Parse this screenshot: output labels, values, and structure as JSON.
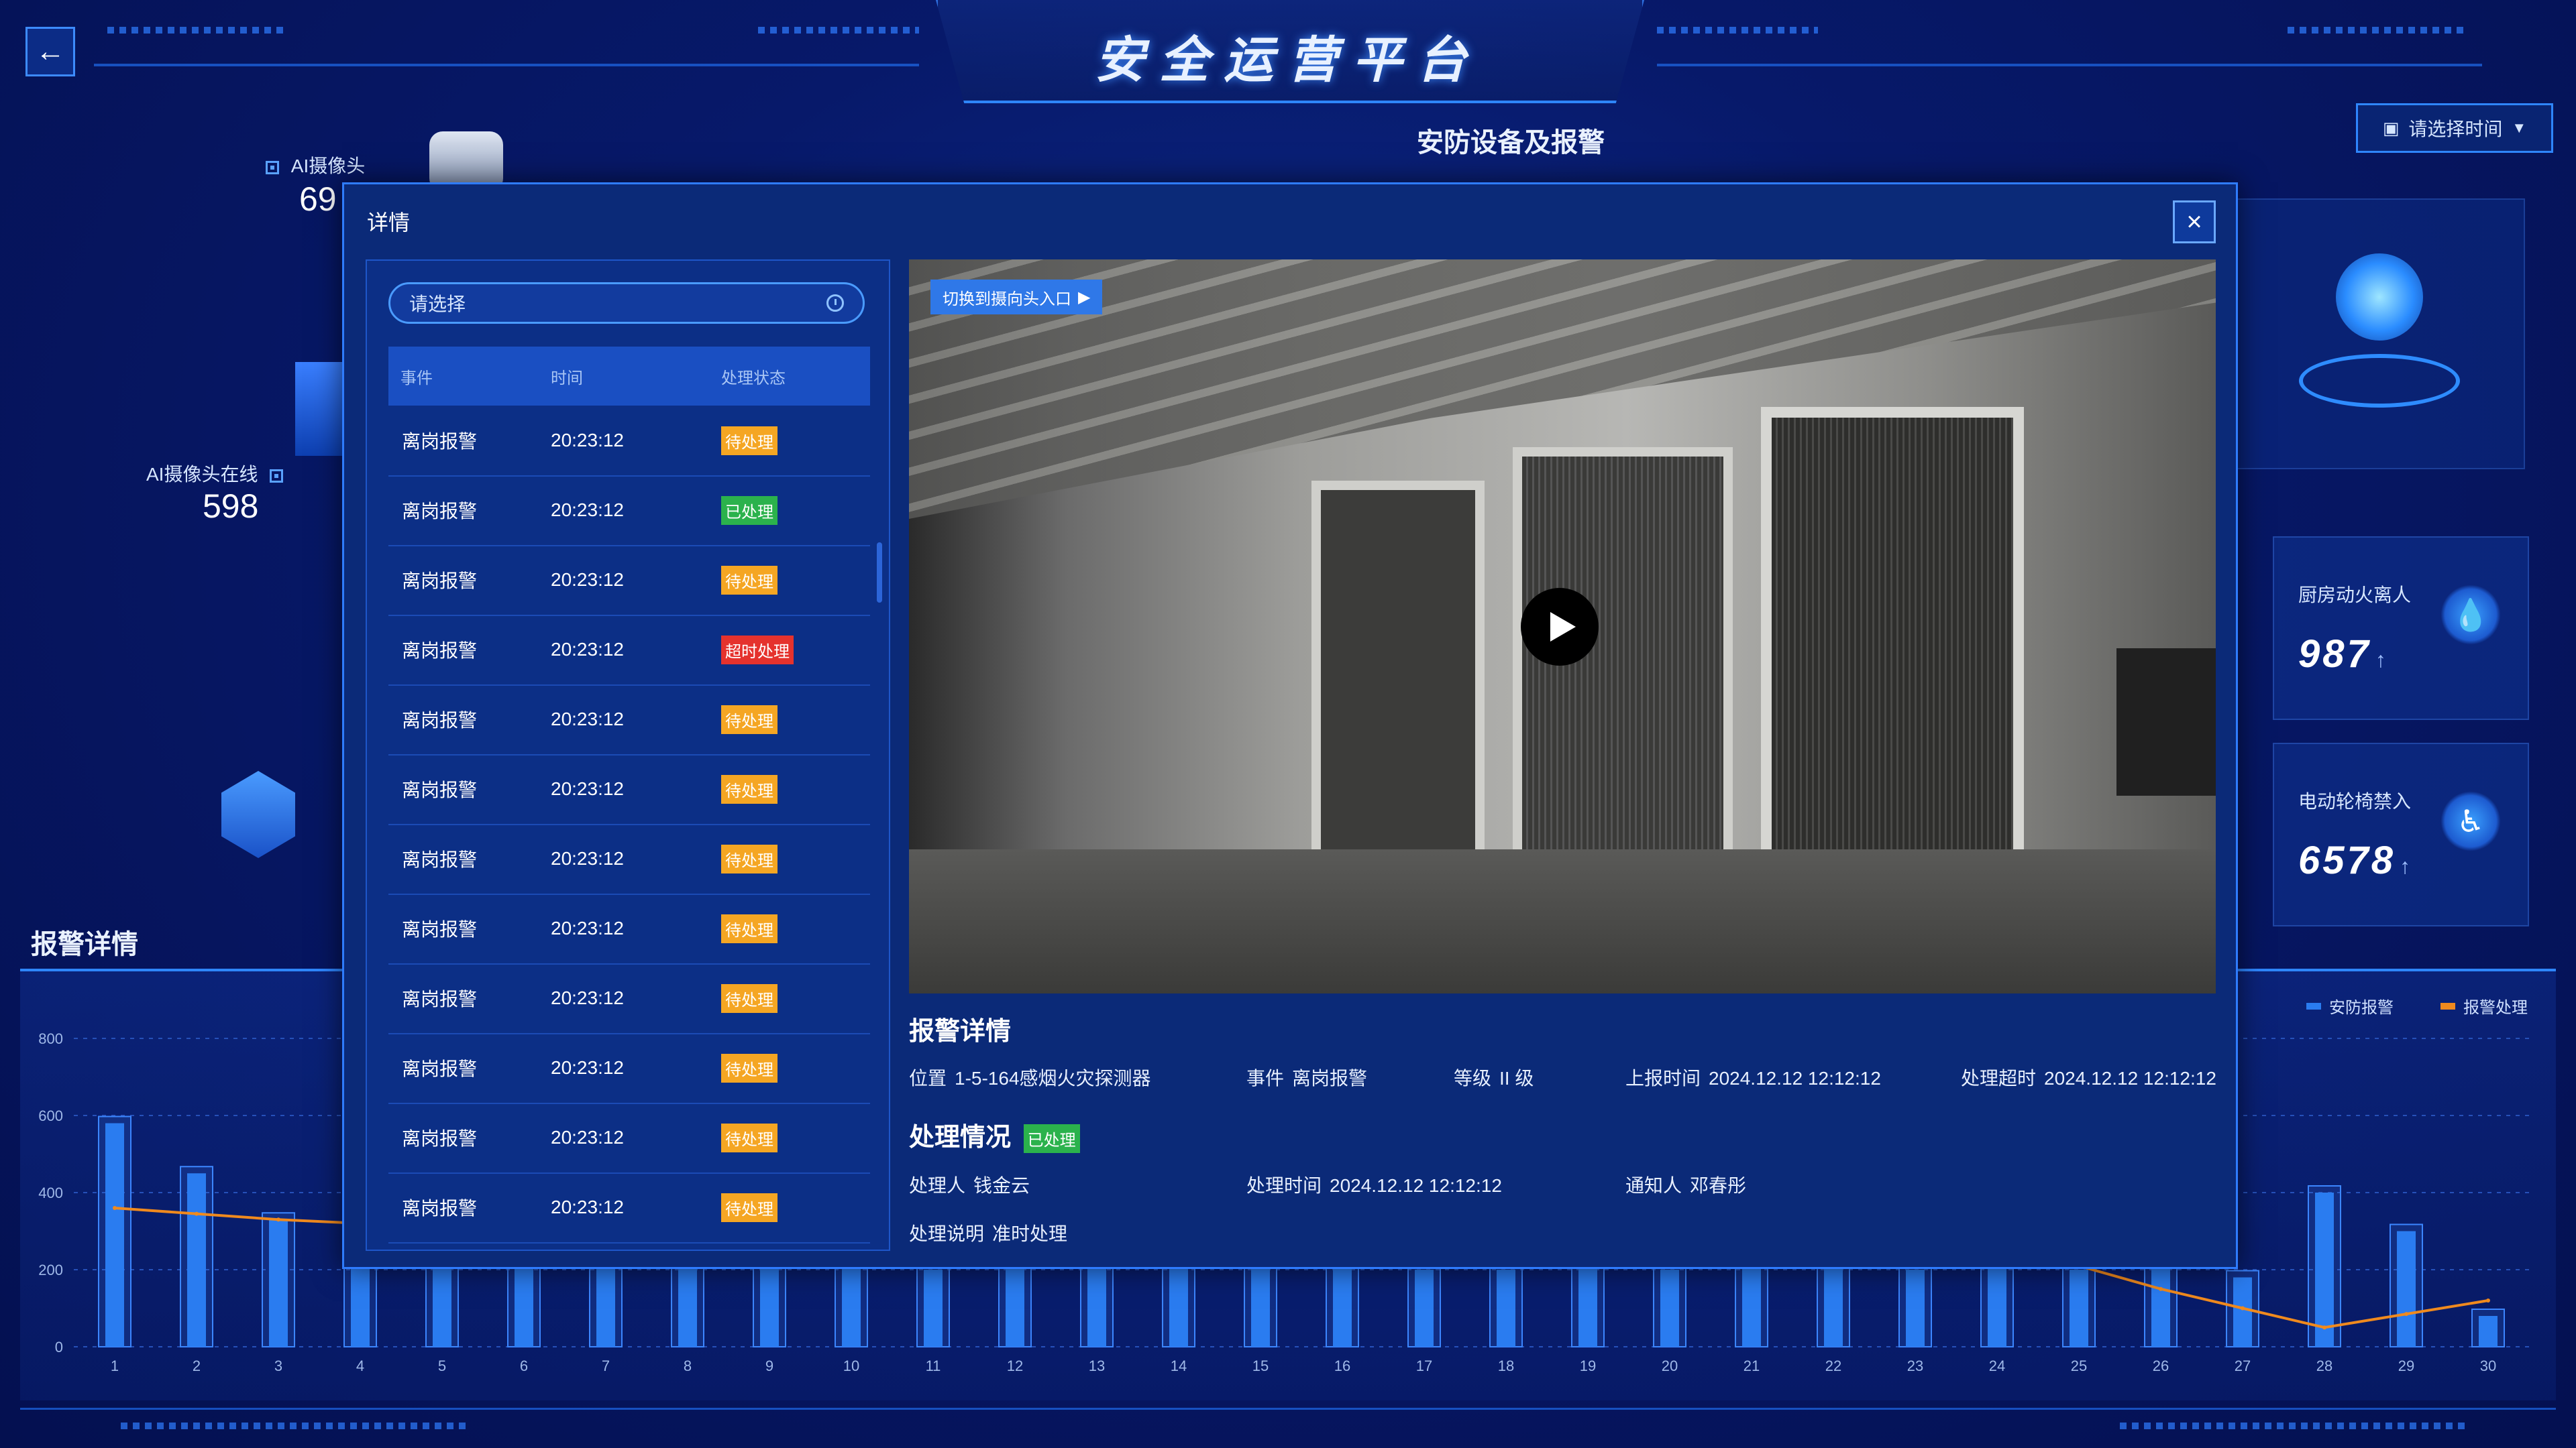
{
  "app": {
    "title": "安全运营平台",
    "time_placeholder": "请选择时间"
  },
  "left": {
    "ai_camera_label": "AI摄像头",
    "ai_camera_value": "69",
    "ai_online_label": "AI摄像头在线",
    "ai_online_value": "598"
  },
  "center": {
    "section_title": "安防设备及报警"
  },
  "right_cards": [
    {
      "label": "厨房动火离人",
      "value": "987",
      "arrow": "↑"
    },
    {
      "label": "电动轮椅禁入",
      "value": "6578",
      "arrow": "↑"
    }
  ],
  "alarm_section": {
    "title": "报警详情"
  },
  "chart_data": {
    "type": "bar",
    "categories": [
      "1",
      "2",
      "3",
      "4",
      "5",
      "6",
      "7",
      "8",
      "9",
      "10",
      "11",
      "12",
      "13",
      "14",
      "15",
      "16",
      "17",
      "18",
      "19",
      "20",
      "21",
      "22",
      "23",
      "24",
      "25",
      "26",
      "27",
      "28",
      "29",
      "30"
    ],
    "series": [
      {
        "name": "安防报警",
        "type": "bar",
        "values": [
          580,
          450,
          330,
          580,
          280,
          220,
          270,
          240,
          260,
          250,
          200,
          260,
          280,
          250,
          220,
          250,
          200,
          200,
          220,
          200,
          210,
          230,
          200,
          240,
          200,
          220,
          180,
          400,
          300,
          80
        ]
      },
      {
        "name": "报警处理",
        "type": "line",
        "values": [
          360,
          345,
          330,
          320,
          300,
          290,
          285,
          280,
          270,
          265,
          260,
          255,
          250,
          245,
          240,
          235,
          230,
          228,
          225,
          222,
          220,
          218,
          215,
          212,
          210,
          150,
          100,
          50,
          85,
          120
        ]
      }
    ],
    "yticks": [
      0,
      200,
      400,
      600,
      800
    ],
    "ylim": [
      0,
      800
    ],
    "legend_position": "top-right",
    "colors": {
      "bar": "#2a7cf0",
      "line": "#f08a1e"
    }
  },
  "modal": {
    "title": "详情",
    "search_placeholder": "请选择",
    "table_headers": [
      "事件",
      "时间",
      "处理状态"
    ],
    "rows": [
      {
        "event": "离岗报警",
        "time": "20:23:12",
        "status": "待处理",
        "kind": "pend"
      },
      {
        "event": "离岗报警",
        "time": "20:23:12",
        "status": "已处理",
        "kind": "done"
      },
      {
        "event": "离岗报警",
        "time": "20:23:12",
        "status": "待处理",
        "kind": "pend"
      },
      {
        "event": "离岗报警",
        "time": "20:23:12",
        "status": "超时处理",
        "kind": "over"
      },
      {
        "event": "离岗报警",
        "time": "20:23:12",
        "status": "待处理",
        "kind": "pend"
      },
      {
        "event": "离岗报警",
        "time": "20:23:12",
        "status": "待处理",
        "kind": "pend"
      },
      {
        "event": "离岗报警",
        "time": "20:23:12",
        "status": "待处理",
        "kind": "pend"
      },
      {
        "event": "离岗报警",
        "time": "20:23:12",
        "status": "待处理",
        "kind": "pend"
      },
      {
        "event": "离岗报警",
        "time": "20:23:12",
        "status": "待处理",
        "kind": "pend"
      },
      {
        "event": "离岗报警",
        "time": "20:23:12",
        "status": "待处理",
        "kind": "pend"
      },
      {
        "event": "离岗报警",
        "time": "20:23:12",
        "status": "待处理",
        "kind": "pend"
      },
      {
        "event": "离岗报警",
        "time": "20:23:12",
        "status": "待处理",
        "kind": "pend"
      }
    ],
    "switch_camera": "切换到摄向头入口",
    "detail_title": "报警详情",
    "detail": {
      "location_label": "位置",
      "location": "1-5-164感烟火灾探测器",
      "event_label": "事件",
      "event": "离岗报警",
      "level_label": "等级",
      "level": "II 级",
      "report_label": "上报时间",
      "report_time": "2024.12.12 12:12:12",
      "overtime_label": "处理超时",
      "overtime": "2024.12.12 12:12:12"
    },
    "handle_title": "处理情况",
    "handle_status": "已处理",
    "handle": {
      "handler_label": "处理人",
      "handler": "钱金云",
      "time_label": "处理时间",
      "time": "2024.12.12 12:12:12",
      "notify_label": "通知人",
      "notify": "邓春彤",
      "desc_label": "处理说明",
      "desc": "准时处理"
    }
  }
}
